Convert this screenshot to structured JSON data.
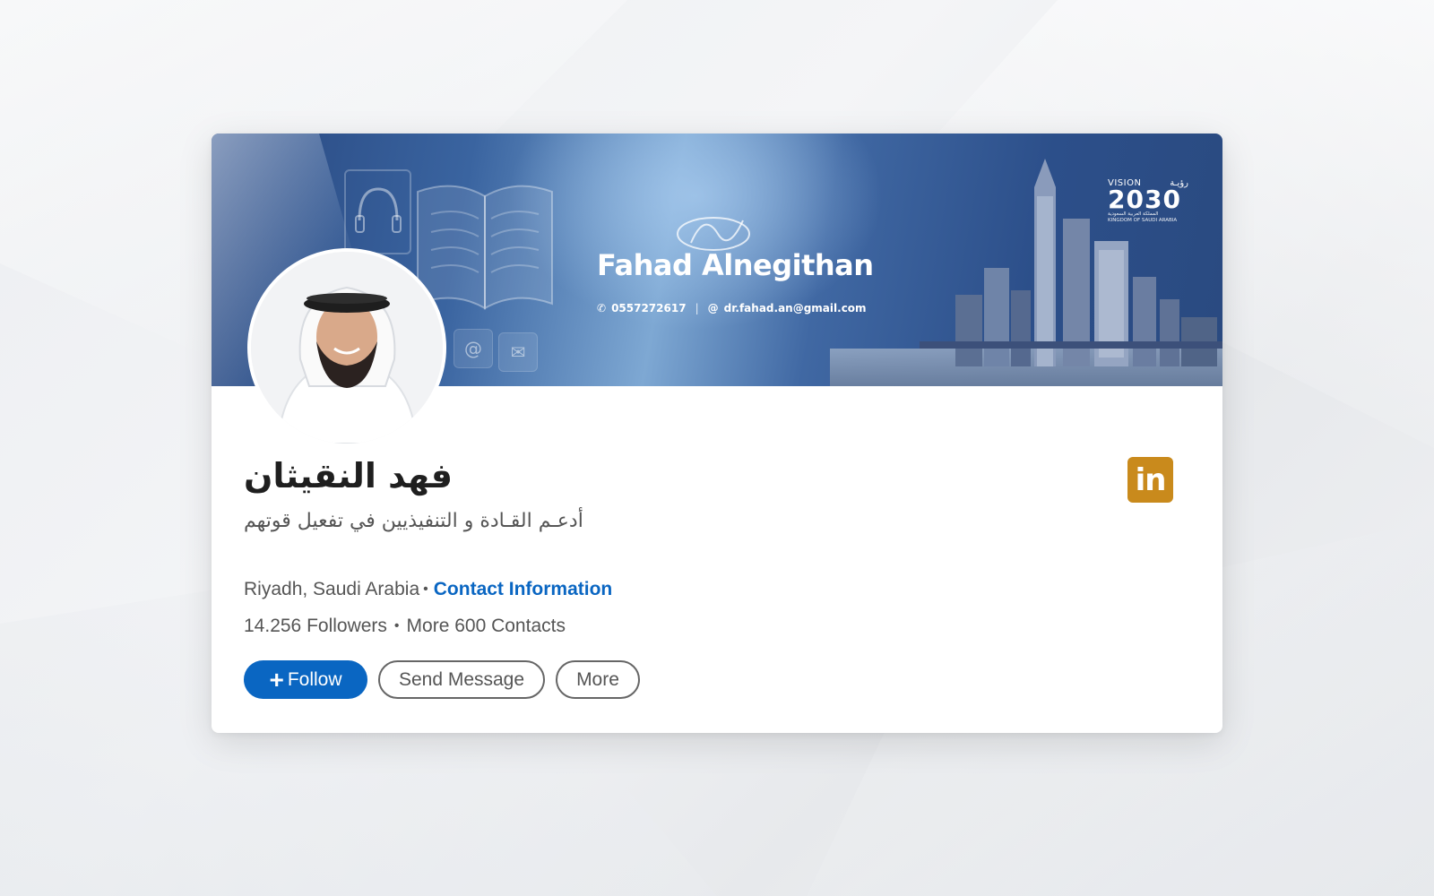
{
  "banner": {
    "name": "Fahad Alnegithan",
    "phone": "0557272617",
    "separator": "|",
    "email": "dr.fahad.an@gmail.com",
    "vision": {
      "label_en": "VISION",
      "label_ar": "رؤيـة",
      "year": "2030",
      "kingdom_ar": "المملكة العربية السعودية",
      "kingdom_en": "KINGDOM OF SAUDI ARABIA"
    }
  },
  "profile": {
    "name": "فهد النقيثان",
    "headline": "أدعـم القـادة و التنفيذيين في تفعيل قوتهم",
    "location": "Riyadh, Saudi Arabia",
    "contact_link": "Contact Information",
    "followers": "14.256 Followers",
    "contacts": "More 600 Contacts"
  },
  "actions": {
    "follow": "Follow",
    "follow_icon": "+",
    "message": "Send Message",
    "more": "More"
  },
  "icons": {
    "linkedin": "in",
    "phone": "✆",
    "at": "@"
  },
  "colors": {
    "accent": "#0a66c2",
    "linkedin_badge": "#c98a1c",
    "banner": "#2c4f8a"
  }
}
